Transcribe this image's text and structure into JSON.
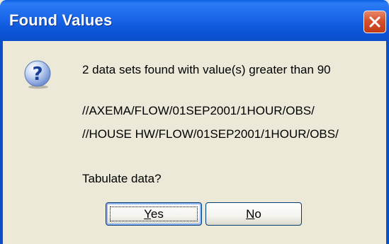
{
  "dialog": {
    "title": "Found Values",
    "icon": "question-icon",
    "message": "2 data sets found with value(s) greater than 90",
    "paths": [
      "//AXEMA/FLOW/01SEP2001/1HOUR/OBS/",
      "//HOUSE HW/FLOW/01SEP2001/1HOUR/OBS/"
    ],
    "prompt": "Tabulate data?",
    "buttons": {
      "yes": {
        "mnemonic": "Y",
        "rest": "es"
      },
      "no": {
        "mnemonic": "N",
        "rest": "o"
      }
    },
    "colors": {
      "titlebar": "#0a5ee0",
      "face": "#ece9d8",
      "close": "#d5512d"
    }
  }
}
